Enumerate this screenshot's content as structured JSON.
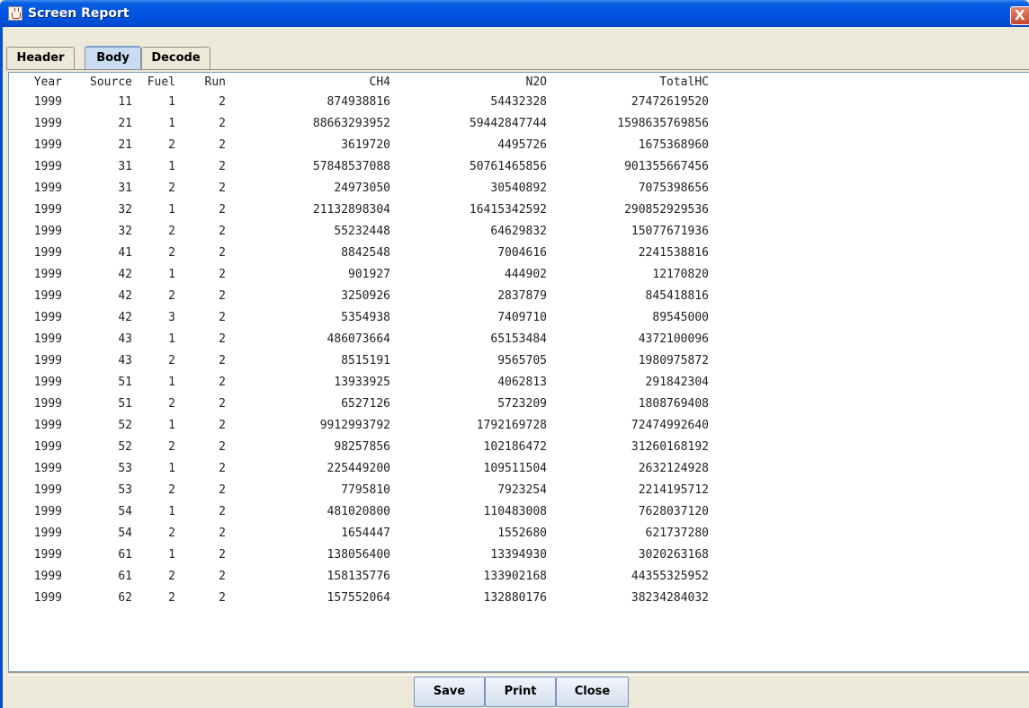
{
  "window": {
    "title": "Screen Report",
    "close_glyph": "X"
  },
  "tabs": [
    {
      "label": "Header",
      "active": false
    },
    {
      "label": "Body",
      "active": true
    },
    {
      "label": "Decode",
      "active": false
    }
  ],
  "table": {
    "columns": [
      "Year",
      "Source",
      "Fuel",
      "Run",
      "CH4",
      "N2O",
      "TotalHC"
    ],
    "rows": [
      [
        "1999",
        "11",
        "1",
        "2",
        "874938816",
        "54432328",
        "27472619520"
      ],
      [
        "1999",
        "21",
        "1",
        "2",
        "88663293952",
        "59442847744",
        "1598635769856"
      ],
      [
        "1999",
        "21",
        "2",
        "2",
        "3619720",
        "4495726",
        "1675368960"
      ],
      [
        "1999",
        "31",
        "1",
        "2",
        "57848537088",
        "50761465856",
        "901355667456"
      ],
      [
        "1999",
        "31",
        "2",
        "2",
        "24973050",
        "30540892",
        "7075398656"
      ],
      [
        "1999",
        "32",
        "1",
        "2",
        "21132898304",
        "16415342592",
        "290852929536"
      ],
      [
        "1999",
        "32",
        "2",
        "2",
        "55232448",
        "64629832",
        "15077671936"
      ],
      [
        "1999",
        "41",
        "2",
        "2",
        "8842548",
        "7004616",
        "2241538816"
      ],
      [
        "1999",
        "42",
        "1",
        "2",
        "901927",
        "444902",
        "12170820"
      ],
      [
        "1999",
        "42",
        "2",
        "2",
        "3250926",
        "2837879",
        "845418816"
      ],
      [
        "1999",
        "42",
        "3",
        "2",
        "5354938",
        "7409710",
        "89545000"
      ],
      [
        "1999",
        "43",
        "1",
        "2",
        "486073664",
        "65153484",
        "4372100096"
      ],
      [
        "1999",
        "43",
        "2",
        "2",
        "8515191",
        "9565705",
        "1980975872"
      ],
      [
        "1999",
        "51",
        "1",
        "2",
        "13933925",
        "4062813",
        "291842304"
      ],
      [
        "1999",
        "51",
        "2",
        "2",
        "6527126",
        "5723209",
        "1808769408"
      ],
      [
        "1999",
        "52",
        "1",
        "2",
        "9912993792",
        "1792169728",
        "72474992640"
      ],
      [
        "1999",
        "52",
        "2",
        "2",
        "98257856",
        "102186472",
        "31260168192"
      ],
      [
        "1999",
        "53",
        "1",
        "2",
        "225449200",
        "109511504",
        "2632124928"
      ],
      [
        "1999",
        "53",
        "2",
        "2",
        "7795810",
        "7923254",
        "2214195712"
      ],
      [
        "1999",
        "54",
        "1",
        "2",
        "481020800",
        "110483008",
        "7628037120"
      ],
      [
        "1999",
        "54",
        "2",
        "2",
        "1654447",
        "1552680",
        "621737280"
      ],
      [
        "1999",
        "61",
        "1",
        "2",
        "138056400",
        "13394930",
        "3020263168"
      ],
      [
        "1999",
        "61",
        "2",
        "2",
        "158135776",
        "133902168",
        "44355325952"
      ],
      [
        "1999",
        "62",
        "2",
        "2",
        "157552064",
        "132880176",
        "38234284032"
      ]
    ]
  },
  "buttons": {
    "save": "Save",
    "print": "Print",
    "close": "Close"
  },
  "icons": {
    "app": "java-cup-icon",
    "close": "close-icon"
  }
}
